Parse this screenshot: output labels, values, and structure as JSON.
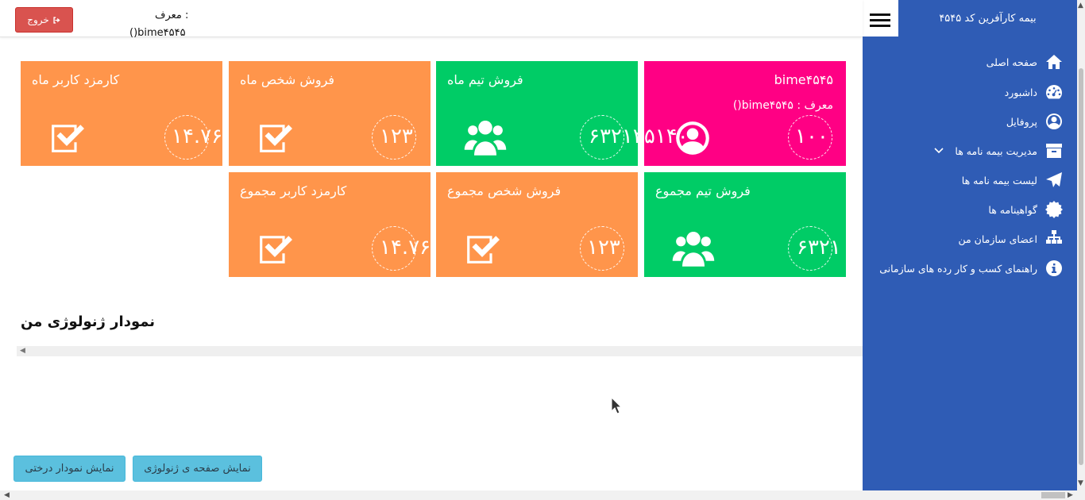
{
  "header": {
    "logout_label": "خروج",
    "referrer_label": "معرف :",
    "referrer_value": "()bime۴۵۴۵",
    "brand_title": "بیمه کارآفرین کد ۴۵۴۵"
  },
  "sidebar": {
    "items": [
      {
        "label": "صفحه اصلی",
        "icon": "home-icon"
      },
      {
        "label": "داشبورد",
        "icon": "dashboard-icon"
      },
      {
        "label": "پروفایل",
        "icon": "user-circle-icon"
      },
      {
        "label": "مدیریت بیمه نامه ها",
        "icon": "archive-icon",
        "has_submenu": true
      },
      {
        "label": "لیست بیمه نامه ها",
        "icon": "paper-plane-icon"
      },
      {
        "label": "گواهینامه ها",
        "icon": "certificate-icon"
      },
      {
        "label": "اعضای سازمان من",
        "icon": "sitemap-icon"
      },
      {
        "label": "راهنمای کسب و کار رده های سازمانی",
        "icon": "info-icon"
      }
    ]
  },
  "cards": [
    {
      "title": "bime۴۵۴۵",
      "subtitle": "معرف : bime۴۵۴۵()",
      "value": "۱۰۰",
      "color": "#ff0084",
      "icon": "user-circle-icon"
    },
    {
      "title": "فروش تیم ماه",
      "value": "۶۳۲۱۳۵۱۴۰",
      "color": "#00cc66",
      "icon": "users-icon"
    },
    {
      "title": "فروش شخص ماه",
      "value": "۱۲۳",
      "color": "#ff954b",
      "icon": "check-square-icon"
    },
    {
      "title": "کارمزد کاربر ماه",
      "value": "۱۴.۷۶",
      "color": "#ff954b",
      "icon": "check-square-icon"
    },
    {
      "title": "فروش تیم مجموع",
      "value": "۶۳۲۱",
      "color": "#00cc66",
      "icon": "users-icon"
    },
    {
      "title": "فروش شخص مجموع",
      "value": "۱۲۳",
      "color": "#ff954b",
      "icon": "check-square-icon"
    },
    {
      "title": "کارمزد کاربر مجموع",
      "value": "۱۴.۷۶",
      "color": "#ff954b",
      "icon": "check-square-icon"
    }
  ],
  "genealogy": {
    "title": "نمودار ژنولوژی من"
  },
  "buttons": {
    "show_genealogy_page": "نمایش صفحه ی ژنولوژی",
    "show_tree_chart": "نمایش نمودار درختی"
  },
  "colors": {
    "sidebar": "#2f5cb5",
    "logout": "#d9534f",
    "info_button": "#5bc0de"
  }
}
